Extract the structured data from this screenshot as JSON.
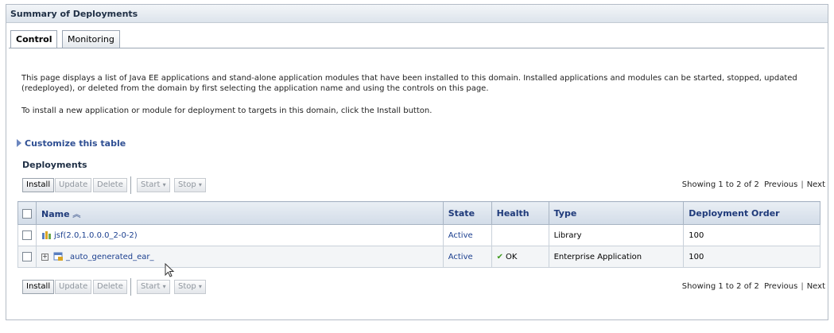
{
  "panel_title": "Summary of Deployments",
  "tabs": [
    {
      "label": "Control",
      "active": true
    },
    {
      "label": "Monitoring",
      "active": false
    }
  ],
  "description": "This page displays a list of Java EE applications and stand-alone application modules that have been installed to this domain. Installed applications and modules can be started, stopped, updated (redeployed), or deleted from the domain by first selecting the application name and using the controls on this page.",
  "install_hint": "To install a new application or module for deployment to targets in this domain, click the Install button.",
  "customize_label": "Customize this table",
  "section_title": "Deployments",
  "toolbar": {
    "install": "Install",
    "update": "Update",
    "delete": "Delete",
    "start": "Start",
    "stop": "Stop",
    "paging_text": "Showing 1 to 2 of 2",
    "previous": "Previous",
    "next": "Next"
  },
  "table": {
    "headers": {
      "name": "Name",
      "state": "State",
      "health": "Health",
      "type": "Type",
      "order": "Deployment Order"
    },
    "rows": [
      {
        "name": "jsf(2.0,1.0.0.0_2-0-2)",
        "state": "Active",
        "health": "",
        "type": "Library",
        "order": "100"
      },
      {
        "name": "_auto_generated_ear_",
        "state": "Active",
        "health": "OK",
        "type": "Enterprise Application",
        "order": "100"
      }
    ]
  },
  "icons": {
    "expander": "plus-expander-icon",
    "health_ok": "green-check-icon",
    "library": "library-icon",
    "ear": "enterprise-app-icon"
  },
  "colors": {
    "link": "#1b3f8f",
    "header_text": "#1f3a7a",
    "ok_check": "#3f9a1f"
  }
}
